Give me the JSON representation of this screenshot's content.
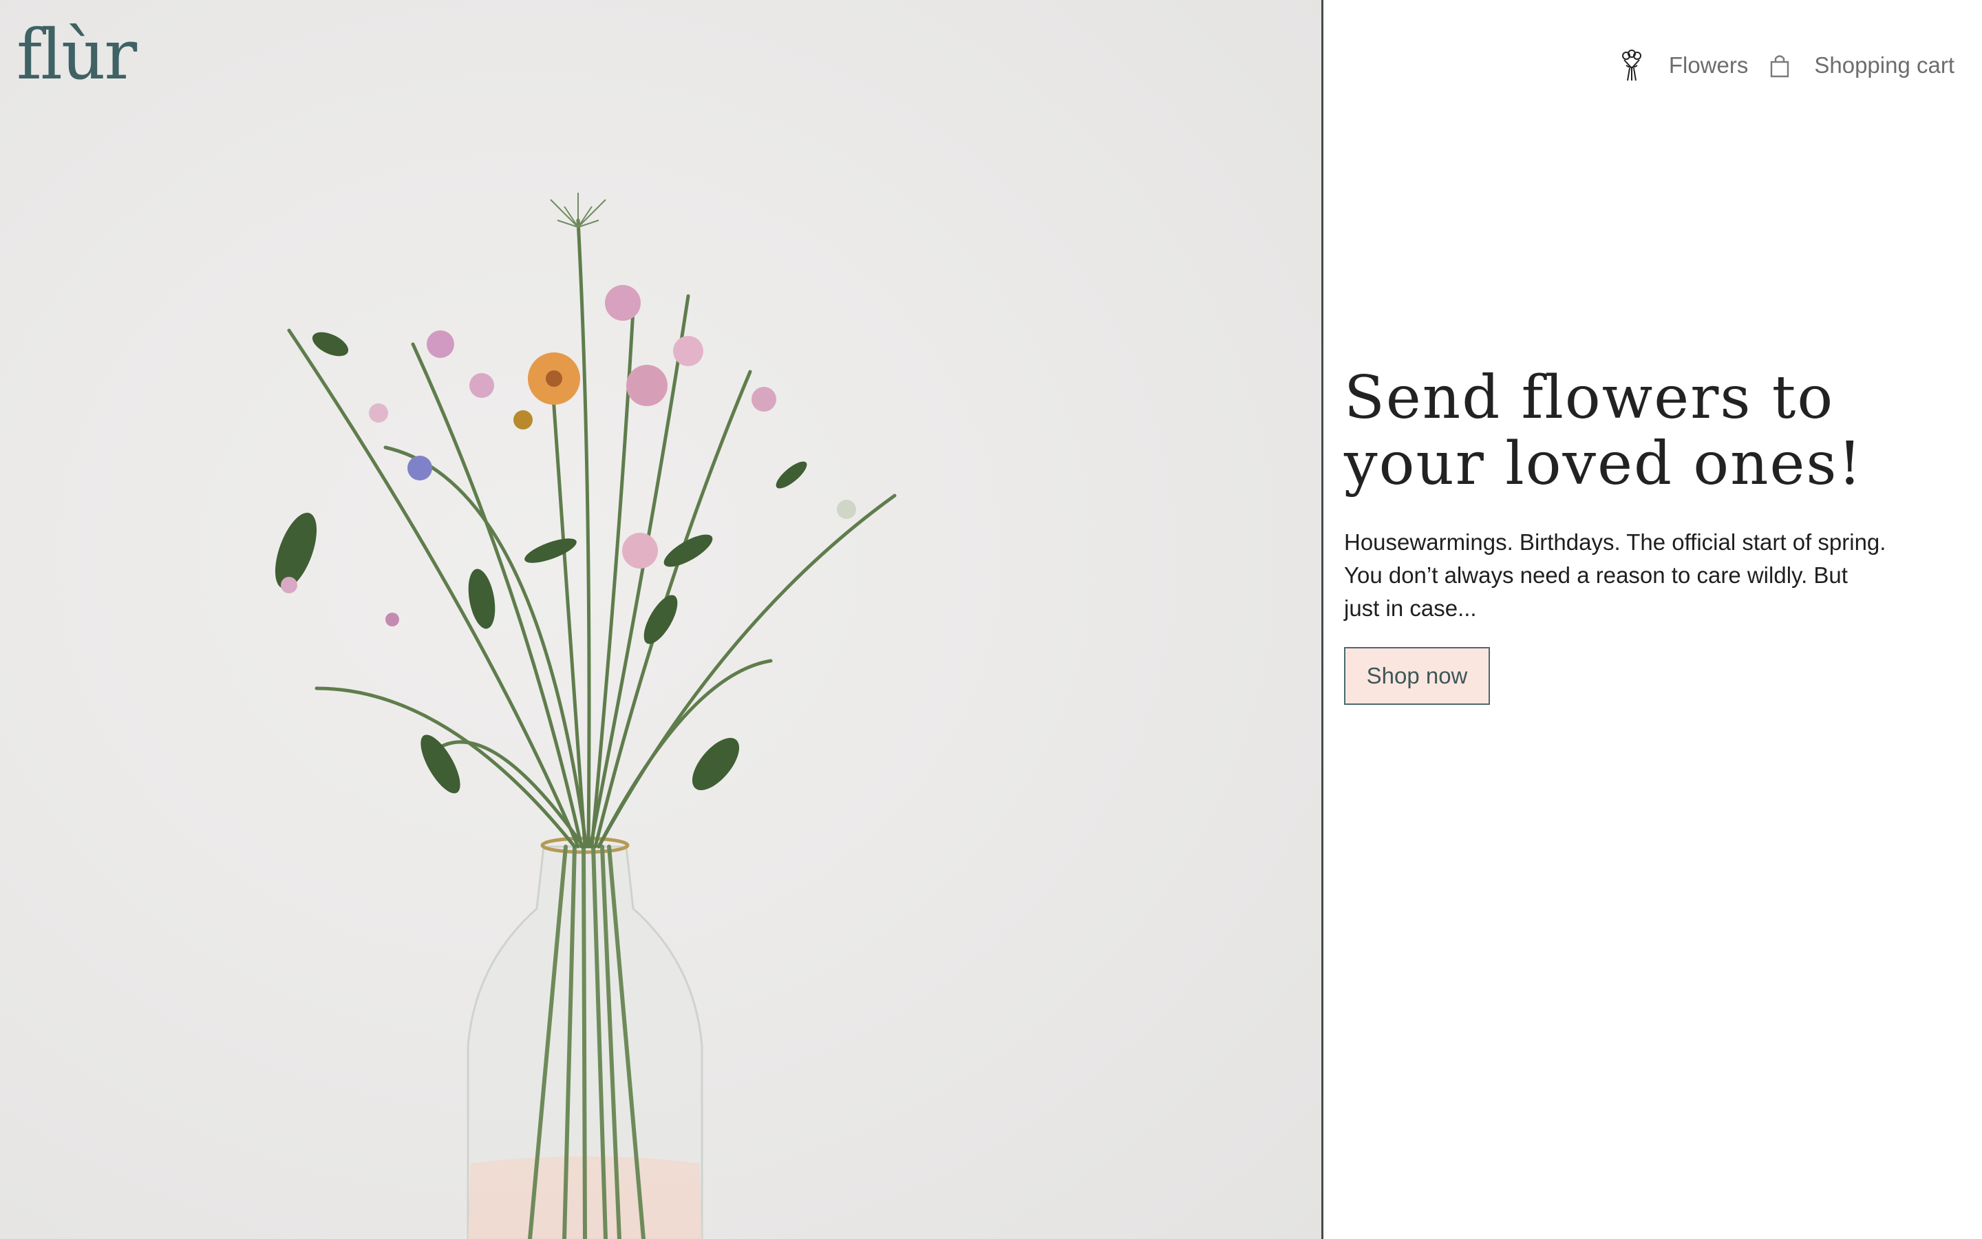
{
  "brand": {
    "logo_text": "flùr",
    "accent_color": "#3f6264"
  },
  "nav": {
    "flowers_icon": "bouquet-icon",
    "flowers_label": "Flowers",
    "cart_icon": "shopping-bag-icon",
    "cart_label": "Shopping cart"
  },
  "hero": {
    "image_subject": "bouquet-of-wildflowers-in-glass-vase",
    "headline": "Send flowers to your loved ones!",
    "blurb": "Housewarmings. Birthdays. The official start of spring. You don’t always need a reason to care wildly. But just in case...",
    "cta_label": "Shop now",
    "cta_background": "#fbe6df",
    "cta_border": "#4a6a6c"
  }
}
